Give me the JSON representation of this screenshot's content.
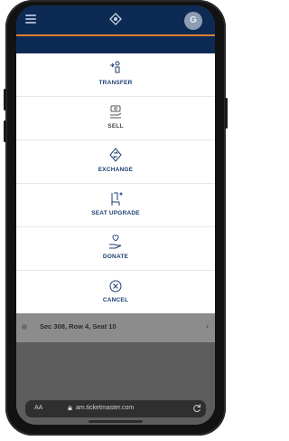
{
  "app": {
    "avatar_initial": "G"
  },
  "menu": {
    "items": [
      {
        "key": "transfer",
        "label": "TRANSFER",
        "icon": "transfer-icon",
        "color": "#1d3e73"
      },
      {
        "key": "sell",
        "label": "SELL",
        "icon": "sell-icon",
        "color": "#444444"
      },
      {
        "key": "exchange",
        "label": "EXCHANGE",
        "icon": "exchange-icon",
        "color": "#1d3e73"
      },
      {
        "key": "seat_upgrade",
        "label": "SEAT UPGRADE",
        "icon": "seat-upgrade-icon",
        "color": "#1d3e73"
      },
      {
        "key": "donate",
        "label": "DONATE",
        "icon": "donate-icon",
        "color": "#1d3e73"
      },
      {
        "key": "cancel",
        "label": "CANCEL",
        "icon": "cancel-icon",
        "color": "#1d3e73"
      }
    ]
  },
  "ticket": {
    "seat_text": "Sec 308, Row 4, Seat 10"
  },
  "browser": {
    "text_size_label": "AA",
    "url": "am.ticketmaster.com"
  },
  "colors": {
    "brand_navy": "#0d2a55",
    "accent_orange": "#d9822b",
    "label_blue": "#1d3e73"
  }
}
